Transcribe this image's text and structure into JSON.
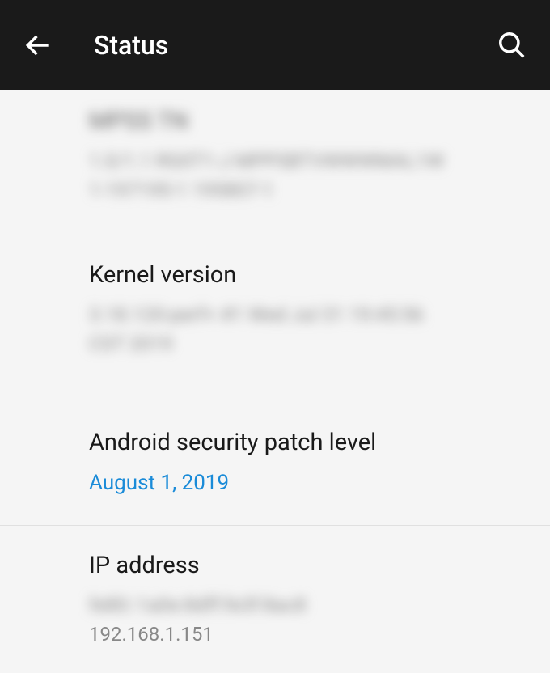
{
  "header": {
    "title": "Status"
  },
  "items": {
    "hidden1": {
      "title": "MPSS TN",
      "value": "1.0/1.1 RG0T1-J MPPSBTVWWWMAL1W 1-197195-1 195807-1"
    },
    "kernel": {
      "title": "Kernel version",
      "value": "3.18.120-perf+\n#1 Wed Jul 31 19:45:56 CST 2019"
    },
    "security": {
      "title": "Android security patch level",
      "value": "August 1, 2019"
    },
    "ip": {
      "title": "IP address",
      "hidden": "fe80::1a0e:8dff:fe3f:8ac8",
      "value": "192.168.1.151"
    }
  }
}
